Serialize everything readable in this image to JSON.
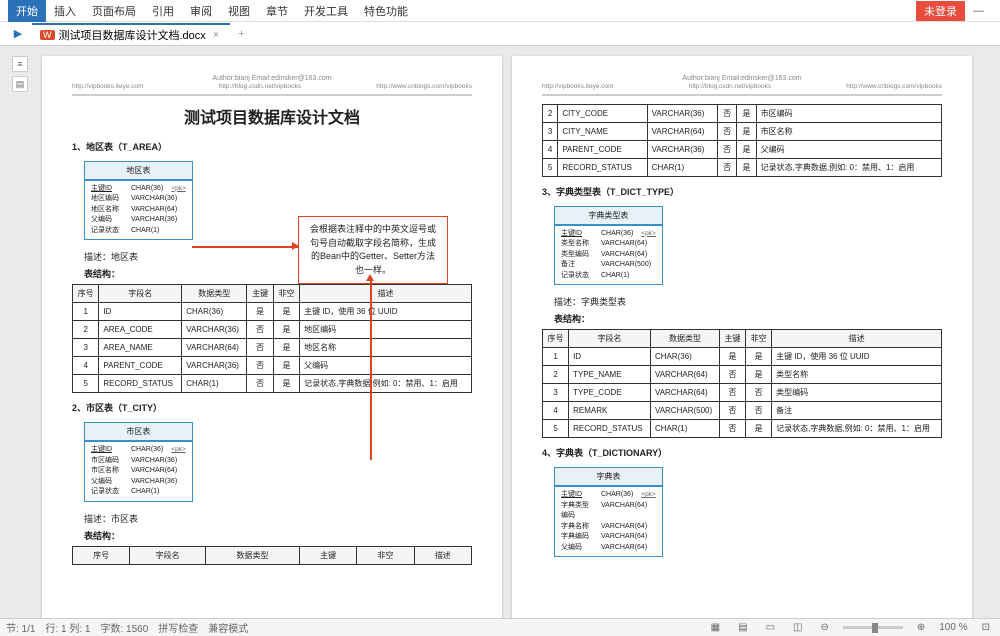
{
  "menubar": {
    "items": [
      "开始",
      "插入",
      "页面布局",
      "引用",
      "审阅",
      "视图",
      "章节",
      "开发工具",
      "特色功能"
    ],
    "login": "未登录"
  },
  "tab": {
    "name": "测试项目数据库设计文档.docx"
  },
  "header": {
    "author": "Author:bianj    Email:edinsker@163.com",
    "url1": "http://vipbooks.iteye.com",
    "url2": "http://blog.csdn.net/vipbooks",
    "url3": "http://www.cnblogs.com/vipbooks"
  },
  "docTitle": "测试项目数据库设计文档",
  "callout": "会根据表注释中的中英文逗号或句号自动截取字段名简称，生成的Bean中的Getter、Setter方法也一样。",
  "sections": {
    "s1": {
      "heading": "1、地区表（T_AREA）",
      "miniTitle": "地区表",
      "miniRows": [
        [
          "主键ID",
          "CHAR(36)",
          "<pk>"
        ],
        [
          "地区编码",
          "VARCHAR(36)",
          ""
        ],
        [
          "地区名称",
          "VARCHAR(64)",
          ""
        ],
        [
          "父编码",
          "VARCHAR(36)",
          ""
        ],
        [
          "记录状态",
          "CHAR(1)",
          ""
        ]
      ],
      "desc": "描述：地区表",
      "struct": "表结构：",
      "cols": [
        "序号",
        "字段名",
        "数据类型",
        "主键",
        "非空",
        "描述"
      ],
      "rows": [
        [
          "1",
          "ID",
          "CHAR(36)",
          "是",
          "是",
          "主键 ID，使用 36 位 UUID"
        ],
        [
          "2",
          "AREA_CODE",
          "VARCHAR(36)",
          "否",
          "是",
          "地区编码"
        ],
        [
          "3",
          "AREA_NAME",
          "VARCHAR(64)",
          "否",
          "是",
          "地区名称"
        ],
        [
          "4",
          "PARENT_CODE",
          "VARCHAR(36)",
          "否",
          "是",
          "父编码"
        ],
        [
          "5",
          "RECORD_STATUS",
          "CHAR(1)",
          "否",
          "是",
          "记录状态,字典数据,例如:\n0：禁用、1：启用"
        ]
      ]
    },
    "s2": {
      "heading": "2、市区表（T_CITY）",
      "miniTitle": "市区表",
      "miniRows": [
        [
          "主键ID",
          "CHAR(36)",
          "<pk>"
        ],
        [
          "市区编码",
          "VARCHAR(36)",
          ""
        ],
        [
          "市区名称",
          "VARCHAR(64)",
          ""
        ],
        [
          "父编码",
          "VARCHAR(36)",
          ""
        ],
        [
          "记录状态",
          "CHAR(1)",
          ""
        ]
      ],
      "desc": "描述：市区表",
      "struct": "表结构：",
      "cols": [
        "序号",
        "字段名",
        "数据类型",
        "主键",
        "非空",
        "描述"
      ]
    },
    "s2b": {
      "rows": [
        [
          "2",
          "CITY_CODE",
          "VARCHAR(36)",
          "否",
          "是",
          "市区编码"
        ],
        [
          "3",
          "CITY_NAME",
          "VARCHAR(64)",
          "否",
          "是",
          "市区名称"
        ],
        [
          "4",
          "PARENT_CODE",
          "VARCHAR(36)",
          "否",
          "是",
          "父编码"
        ],
        [
          "5",
          "RECORD_STATUS",
          "CHAR(1)",
          "否",
          "是",
          "记录状态,字典数据,例如:\n0：禁用、1：启用"
        ]
      ]
    },
    "s3": {
      "heading": "3、字典类型表（T_DICT_TYPE）",
      "miniTitle": "字典类型表",
      "miniRows": [
        [
          "主键ID",
          "CHAR(36)",
          "<pk>"
        ],
        [
          "类型名称",
          "VARCHAR(64)",
          ""
        ],
        [
          "类型编码",
          "VARCHAR(64)",
          ""
        ],
        [
          "备注",
          "VARCHAR(500)",
          ""
        ],
        [
          "记录状态",
          "CHAR(1)",
          ""
        ]
      ],
      "desc": "描述：字典类型表",
      "struct": "表结构：",
      "cols": [
        "序号",
        "字段名",
        "数据类型",
        "主键",
        "非空",
        "描述"
      ],
      "rows": [
        [
          "1",
          "ID",
          "CHAR(36)",
          "是",
          "是",
          "主键 ID，使用 36 位 UUID"
        ],
        [
          "2",
          "TYPE_NAME",
          "VARCHAR(64)",
          "否",
          "是",
          "类型名称"
        ],
        [
          "3",
          "TYPE_CODE",
          "VARCHAR(64)",
          "否",
          "否",
          "类型编码"
        ],
        [
          "4",
          "REMARK",
          "VARCHAR(500)",
          "否",
          "否",
          "备注"
        ],
        [
          "5",
          "RECORD_STATUS",
          "CHAR(1)",
          "否",
          "是",
          "记录状态,字典数据,例如:\n0：禁用、1：启用"
        ]
      ]
    },
    "s4": {
      "heading": "4、字典表（T_DICTIONARY）",
      "miniTitle": "字典表",
      "miniRows": [
        [
          "主键ID",
          "CHAR(36)",
          "<pk>"
        ],
        [
          "字典类型编码",
          "VARCHAR(64)",
          ""
        ],
        [
          "字典名称",
          "VARCHAR(64)",
          ""
        ],
        [
          "字典编码",
          "VARCHAR(64)",
          ""
        ],
        [
          "父编码",
          "VARCHAR(64)",
          ""
        ]
      ]
    }
  },
  "statusbar": {
    "page": "节: 1/1",
    "line": "行: 1  列: 1",
    "words": "字数: 1560",
    "spell": "拼写检查",
    "compat": "兼容模式",
    "zoom": "100 %"
  }
}
